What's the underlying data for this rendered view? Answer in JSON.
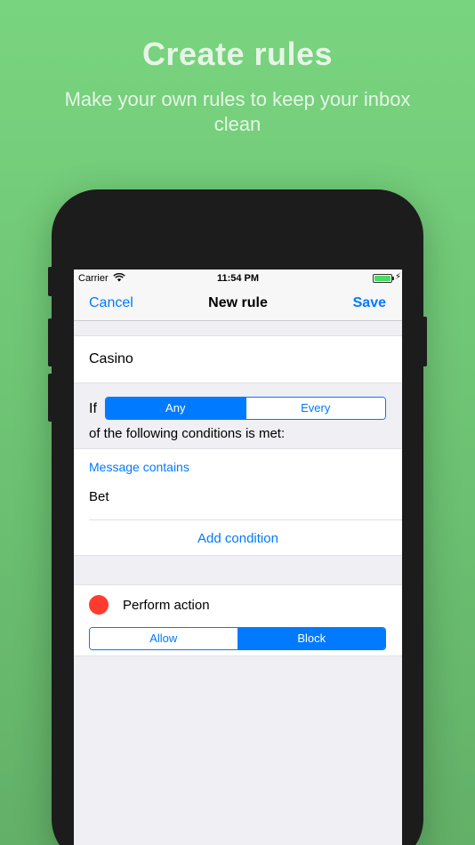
{
  "hero": {
    "title": "Create rules",
    "subtitle": "Make your own rules to keep your inbox clean"
  },
  "status_bar": {
    "carrier": "Carrier",
    "time": "11:54 PM",
    "battery_level": 1.0
  },
  "nav": {
    "cancel": "Cancel",
    "title": "New rule",
    "save": "Save"
  },
  "rule": {
    "name": "Casino",
    "if_label": "If",
    "match_options": [
      "Any",
      "Every"
    ],
    "match_selected": "Any",
    "condition_text": "of the following conditions is met:",
    "condition_type": "Message contains",
    "condition_value": "Bet",
    "add_condition": "Add condition"
  },
  "action": {
    "label": "Perform action",
    "options": [
      "Allow",
      "Block"
    ],
    "selected": "Block",
    "indicator_color": "#ff3b30"
  },
  "colors": {
    "accent": "#007aff",
    "background_green": "#79d47f"
  }
}
